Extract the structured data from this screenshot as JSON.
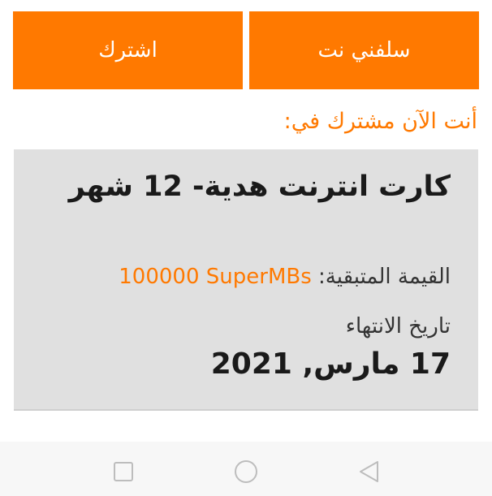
{
  "actions": {
    "subscribe_label": "اشترك",
    "borrow_label": "سلفني نت"
  },
  "subscription": {
    "heading": "أنت الآن مشترك في:",
    "plan_name": "كارت انترنت هدية- 12 شهر",
    "remaining_label": "القيمة المتبقية:",
    "remaining_value": "100000 SuperMBs",
    "expiry_label": "تاريخ الانتهاء",
    "expiry_date": "17 مارس, 2021"
  },
  "navbar": {
    "icons": [
      "recents-icon",
      "home-icon",
      "back-icon"
    ]
  },
  "colors": {
    "accent": "#ff7900",
    "card_bg": "#e0e0e0",
    "text_dark": "#1a1a1a",
    "navbar_bg": "#f7f7f7"
  }
}
